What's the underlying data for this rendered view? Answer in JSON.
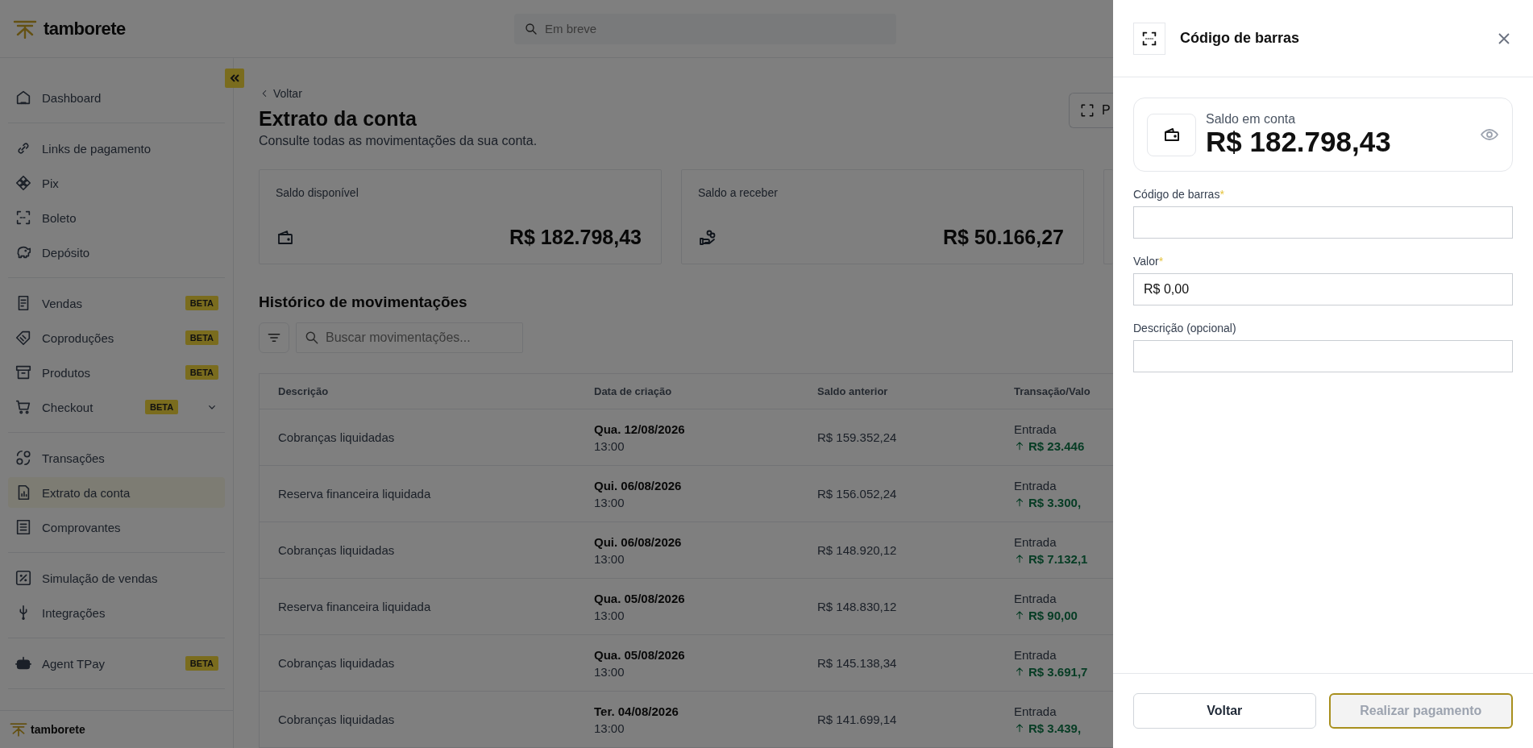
{
  "header": {
    "logo": "tamborete",
    "search": {
      "placeholder": "Em breve"
    }
  },
  "sidebar": {
    "groups": [
      [
        {
          "label": "Dashboard",
          "selected": false
        }
      ],
      [
        {
          "label": "Links de pagamento",
          "selected": false
        },
        {
          "label": "Pix",
          "selected": false
        },
        {
          "label": "Boleto",
          "selected": false
        },
        {
          "label": "Depósito",
          "selected": false
        }
      ],
      [
        {
          "label": "Vendas",
          "badge": "BETA",
          "selected": false
        },
        {
          "label": "Coproduções",
          "badge": "BETA",
          "selected": false
        },
        {
          "label": "Produtos",
          "badge": "BETA",
          "selected": false
        },
        {
          "label": "Checkout",
          "badge": "BETA",
          "selected": false,
          "expanded": false
        }
      ],
      [
        {
          "label": "Transações",
          "selected": false
        },
        {
          "label": "Extrato da conta",
          "selected": true
        },
        {
          "label": "Comprovantes",
          "selected": false
        }
      ],
      [
        {
          "label": "Simulação de vendas",
          "selected": false
        },
        {
          "label": "Integrações",
          "selected": false
        }
      ],
      [
        {
          "label": "Agent TPay",
          "badge": "BETA",
          "selected": false
        }
      ]
    ],
    "footer_logo": "tamborete"
  },
  "page": {
    "back_link": "Voltar",
    "title": "Extrato da conta",
    "subtitle": "Consulte todas as movimentações da sua conta.",
    "action_button": "P",
    "cards": [
      {
        "label": "Saldo disponível",
        "value": "R$ 182.798,43"
      },
      {
        "label": "Saldo a receber",
        "value": "R$ 50.166,27"
      }
    ],
    "history": {
      "title": "Histórico de movimentações",
      "search": {
        "placeholder": "Buscar movimentações..."
      },
      "table": {
        "columns": [
          "Descrição",
          "Data de criação",
          "Saldo anterior",
          "Transação/Valo"
        ],
        "rows": [
          {
            "description": "Cobranças liquidadas",
            "date": "Qua. 12/08/2026",
            "time": "13:00",
            "balance": "R$ 159.352,24",
            "type": "Entrada",
            "amount": "R$ 23.446"
          },
          {
            "description": "Reserva financeira liquidada",
            "date": "Qui. 06/08/2026",
            "time": "13:00",
            "balance": "R$ 156.052,24",
            "type": "Entrada",
            "amount": "R$ 3.300,"
          },
          {
            "description": "Cobranças liquidadas",
            "date": "Qui. 06/08/2026",
            "time": "13:00",
            "balance": "R$ 148.920,12",
            "type": "Entrada",
            "amount": "R$ 7.132,1"
          },
          {
            "description": "Reserva financeira liquidada",
            "date": "Qua. 05/08/2026",
            "time": "13:00",
            "balance": "R$ 148.830,12",
            "type": "Entrada",
            "amount": "R$ 90,00"
          },
          {
            "description": "Cobranças liquidadas",
            "date": "Qua. 05/08/2026",
            "time": "13:00",
            "balance": "R$ 145.138,34",
            "type": "Entrada",
            "amount": "R$ 3.691,7"
          },
          {
            "description": "Cobranças liquidadas",
            "date": "Ter. 04/08/2026",
            "time": "13:00",
            "balance": "R$ 141.699,14",
            "type": "Entrada",
            "amount": "R$ 3.439,"
          }
        ]
      }
    }
  },
  "drawer": {
    "title": "Código de barras",
    "balance": {
      "label": "Saldo em conta",
      "value": "R$ 182.798,43"
    },
    "fields": [
      {
        "label": "Código de barras",
        "mark": "*"
      },
      {
        "label": "Valor",
        "mark": "*",
        "value": "R$ 0,00"
      },
      {
        "label": "Descrição (opcional)"
      }
    ],
    "buttons": [
      {
        "label": "Voltar",
        "kind": "secondary",
        "disabled": false
      },
      {
        "label": "Realizar pagamento",
        "kind": "primary",
        "disabled": true
      }
    ]
  }
}
